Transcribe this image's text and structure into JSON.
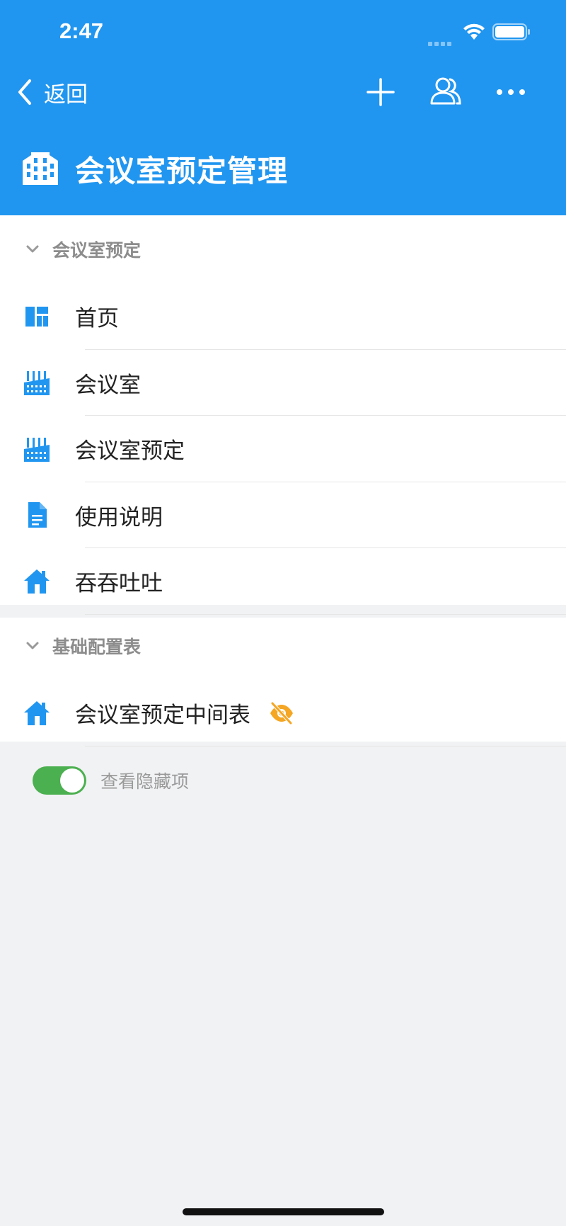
{
  "status_bar": {
    "time": "2:47"
  },
  "nav": {
    "back_label": "返回",
    "icons": [
      "chevron-left-icon",
      "plus-icon",
      "members-icon",
      "more-icon"
    ]
  },
  "app": {
    "title": "会议室预定管理",
    "icon": "building-icon"
  },
  "sections": [
    {
      "title": "会议室预定",
      "items": [
        {
          "label": "首页",
          "icon": "dashboard-icon"
        },
        {
          "label": "会议室",
          "icon": "factory-icon"
        },
        {
          "label": "会议室预定",
          "icon": "factory-icon"
        },
        {
          "label": "使用说明",
          "icon": "document-icon"
        },
        {
          "label": "吞吞吐吐",
          "icon": "home-icon"
        }
      ]
    },
    {
      "title": "基础配置表",
      "items": [
        {
          "label": "会议室预定中间表",
          "icon": "home-icon",
          "hidden": true
        }
      ]
    }
  ],
  "toggle": {
    "label": "查看隐藏项",
    "on": true
  },
  "colors": {
    "header": "#2196f0",
    "icon": "#2196f0",
    "toggle_on": "#4bb04f",
    "hidden_icon": "#f5a623",
    "background": "#f1f2f4"
  }
}
